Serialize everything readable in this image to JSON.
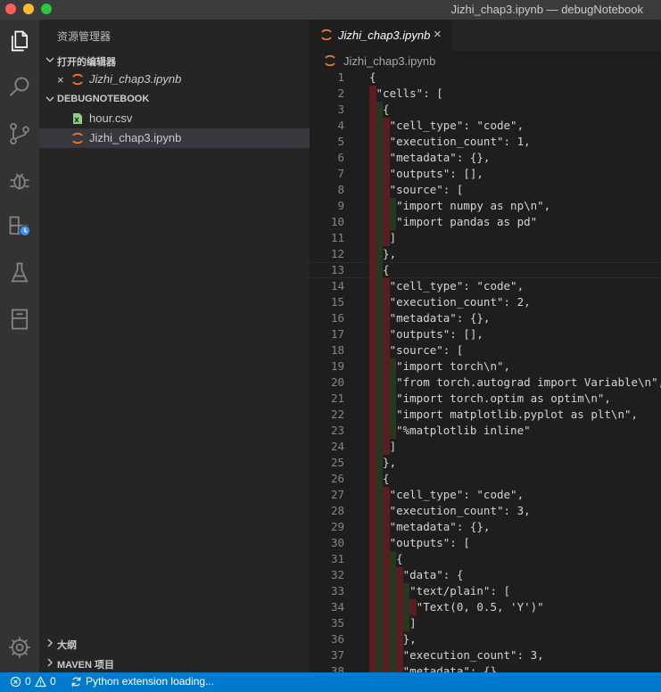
{
  "window": {
    "title": "Jizhi_chap3.ipynb — debugNotebook"
  },
  "activity_bar": {
    "items": [
      "explorer-icon",
      "search-icon",
      "source-control-icon",
      "debug-icon",
      "extensions-icon",
      "testing-icon",
      "notebook-icon"
    ],
    "bottom": "settings-gear-icon"
  },
  "sidebar": {
    "title": "资源管理器",
    "open_editors": {
      "label": "打开的编辑器",
      "items": [
        {
          "name": "Jizhi_chap3.ipynb",
          "close": "×"
        }
      ]
    },
    "folder": {
      "label": "DEBUGNOTEBOOK",
      "items": [
        {
          "name": "hour.csv",
          "icon": "csv-file-icon"
        },
        {
          "name": "Jizhi_chap3.ipynb",
          "icon": "jupyter-file-icon"
        }
      ]
    },
    "outline": {
      "label": "大纲"
    },
    "maven": {
      "label": "MAVEN 项目"
    }
  },
  "editor": {
    "tab": {
      "name": "Jizhi_chap3.ipynb",
      "close": "×"
    },
    "breadcrumb": "Jizhi_chap3.ipynb",
    "lines": [
      {
        "n": "1",
        "t": "{"
      },
      {
        "n": "2",
        "t": " \"cells\": ["
      },
      {
        "n": "3",
        "t": "  {"
      },
      {
        "n": "4",
        "t": "   \"cell_type\": \"code\","
      },
      {
        "n": "5",
        "t": "   \"execution_count\": 1,"
      },
      {
        "n": "6",
        "t": "   \"metadata\": {},"
      },
      {
        "n": "7",
        "t": "   \"outputs\": [],"
      },
      {
        "n": "8",
        "t": "   \"source\": ["
      },
      {
        "n": "9",
        "t": "    \"import numpy as np\\n\","
      },
      {
        "n": "10",
        "t": "    \"import pandas as pd\""
      },
      {
        "n": "11",
        "t": "   ]"
      },
      {
        "n": "12",
        "t": "  },"
      },
      {
        "n": "13",
        "t": "  {"
      },
      {
        "n": "14",
        "t": "   \"cell_type\": \"code\","
      },
      {
        "n": "15",
        "t": "   \"execution_count\": 2,"
      },
      {
        "n": "16",
        "t": "   \"metadata\": {},"
      },
      {
        "n": "17",
        "t": "   \"outputs\": [],"
      },
      {
        "n": "18",
        "t": "   \"source\": ["
      },
      {
        "n": "19",
        "t": "    \"import torch\\n\","
      },
      {
        "n": "20",
        "t": "    \"from torch.autograd import Variable\\n\","
      },
      {
        "n": "21",
        "t": "    \"import torch.optim as optim\\n\","
      },
      {
        "n": "22",
        "t": "    \"import matplotlib.pyplot as plt\\n\","
      },
      {
        "n": "23",
        "t": "    \"%matplotlib inline\""
      },
      {
        "n": "24",
        "t": "   ]"
      },
      {
        "n": "25",
        "t": "  },"
      },
      {
        "n": "26",
        "t": "  {"
      },
      {
        "n": "27",
        "t": "   \"cell_type\": \"code\","
      },
      {
        "n": "28",
        "t": "   \"execution_count\": 3,"
      },
      {
        "n": "29",
        "t": "   \"metadata\": {},"
      },
      {
        "n": "30",
        "t": "   \"outputs\": ["
      },
      {
        "n": "31",
        "t": "    {"
      },
      {
        "n": "32",
        "t": "     \"data\": {"
      },
      {
        "n": "33",
        "t": "      \"text/plain\": ["
      },
      {
        "n": "34",
        "t": "       \"Text(0, 0.5, 'Y')\""
      },
      {
        "n": "35",
        "t": "      ]"
      },
      {
        "n": "36",
        "t": "     },"
      },
      {
        "n": "37",
        "t": "     \"execution_count\": 3,"
      },
      {
        "n": "38",
        "t": "     \"metadata\": {},"
      }
    ]
  },
  "statusbar": {
    "errors": "0",
    "warnings": "0",
    "message": "Python extension loading..."
  },
  "colors": {
    "status_bg": "#007acc",
    "indent_red": "#5a1d22",
    "indent_green": "#26391f",
    "jupyter_orange": "#f37726",
    "csv_green": "#89d185"
  }
}
